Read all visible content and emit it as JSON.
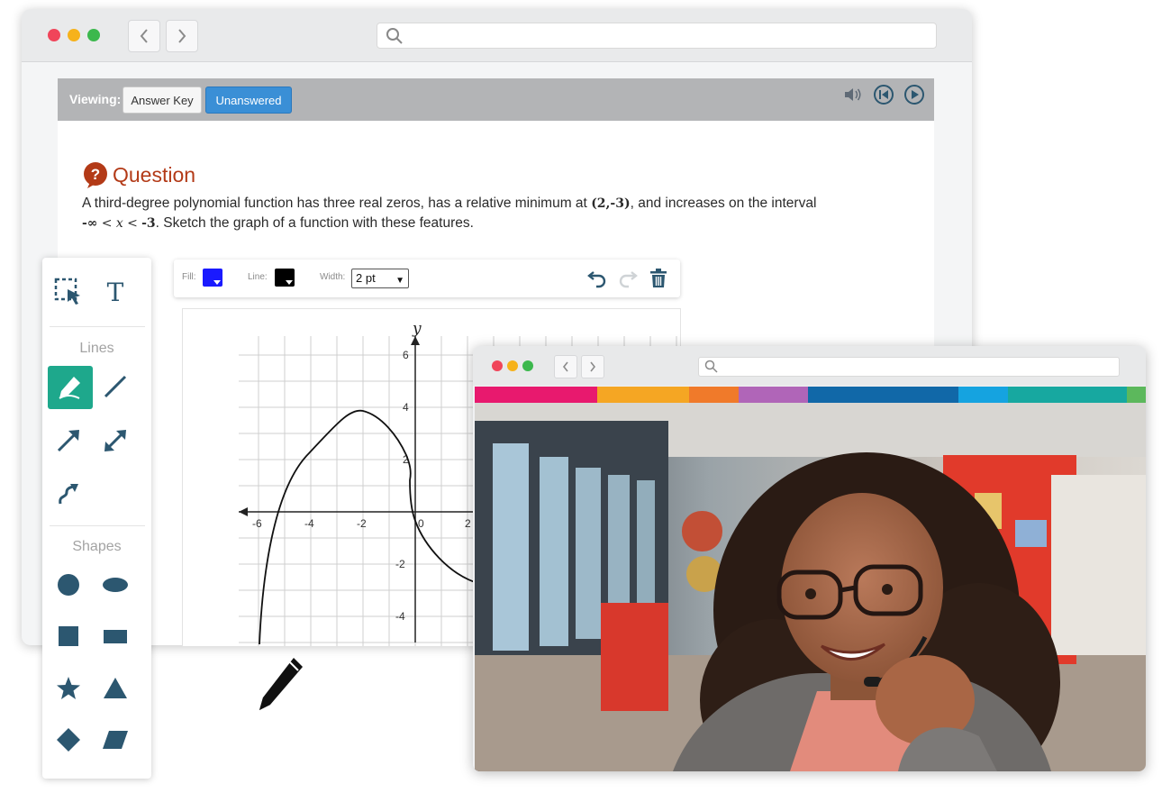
{
  "viewer": {
    "viewing_label": "Viewing:",
    "answer_key_label": "Answer Key",
    "unanswered_label": "Unanswered"
  },
  "question": {
    "title": "Question",
    "text_part1": "A third-degree polynomial function has three real zeros, has a relative minimum at",
    "min_point": "(2,-3)",
    "text_part2": ", and increases on the interval",
    "interval_left": "-∞",
    "interval_lt1": "<",
    "interval_var": "x",
    "interval_lt2": "<",
    "interval_right": "-3",
    "text_part3": ". Sketch the graph of a function with these features."
  },
  "draw_toolbar": {
    "fill_label": "Fill:",
    "line_label": "Line:",
    "width_label": "Width:",
    "width_value": "2 pt",
    "fill_color": "#1a1aff",
    "line_color": "#000000"
  },
  "palette": {
    "lines_title": "Lines",
    "shapes_title": "Shapes",
    "text_tool": "T"
  },
  "graph": {
    "y_axis_label": "y",
    "x_ticks": [
      "-6",
      "-4",
      "-2",
      "0",
      "2"
    ],
    "y_ticks": [
      "6",
      "4",
      "2",
      "-2",
      "-4"
    ]
  },
  "colors": {
    "accent": "#1ea88c",
    "primary_button": "#3a8fd6",
    "question_color": "#b33a17",
    "stripes": [
      "#e8196e",
      "#f5a623",
      "#f07a2a",
      "#b065b8",
      "#1168a8",
      "#15a3e0",
      "#17a8a0",
      "#5cb85c"
    ]
  },
  "icons": [
    "search-icon",
    "back-icon",
    "forward-icon",
    "volume-icon",
    "skip-back-icon",
    "play-icon",
    "question-icon",
    "undo-icon",
    "redo-icon",
    "trash-icon",
    "select-icon",
    "pencil-icon",
    "line-icon",
    "arrow-icon",
    "double-arrow-icon",
    "curved-arrow-icon",
    "circle-icon",
    "ellipse-icon",
    "square-icon",
    "rectangle-icon",
    "star-icon",
    "triangle-icon",
    "diamond-icon",
    "parallelogram-icon"
  ]
}
